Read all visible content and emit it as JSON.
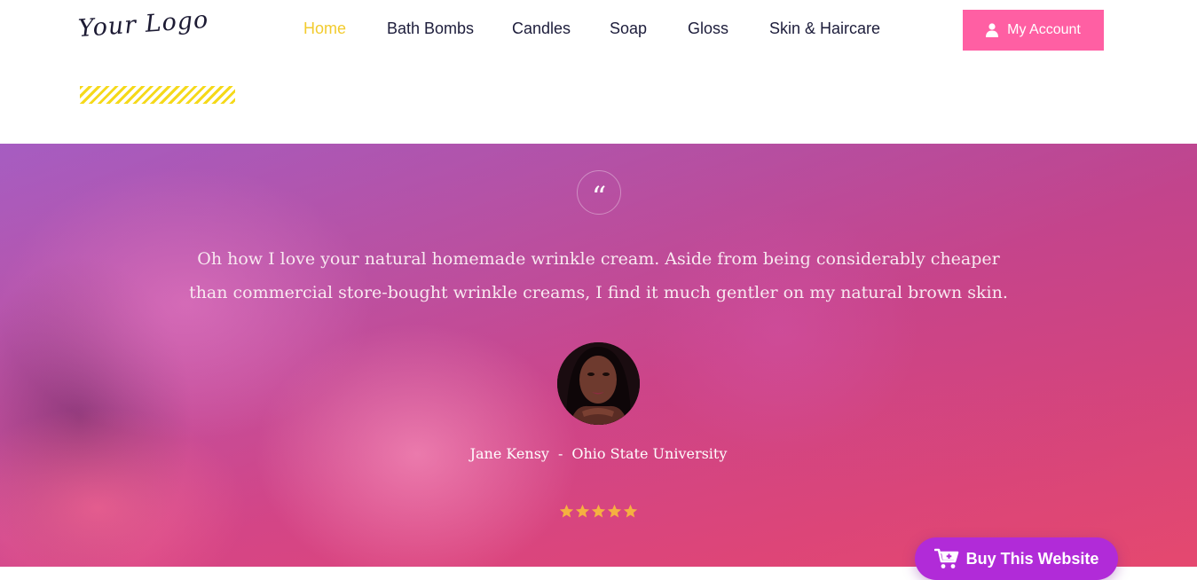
{
  "header": {
    "logo_text": "Your Logo",
    "nav": [
      {
        "label": "Home",
        "active": true
      },
      {
        "label": "Bath Bombs",
        "active": false
      },
      {
        "label": "Candles",
        "active": false
      },
      {
        "label": "Soap",
        "active": false
      },
      {
        "label": "Gloss",
        "active": false
      },
      {
        "label": "Skin & Haircare",
        "active": false
      }
    ],
    "account_label": "My Account",
    "account_icon": "user-icon"
  },
  "testimonial": {
    "quote_mark": "“",
    "quote": "Oh how I love your natural homemade wrinkle cream. Aside from being considerably cheaper than commercial store-bought wrinkle creams, I find it much gentler on my natural brown skin.",
    "author_name": "Jane Kensy",
    "separator": "-",
    "author_org": "Ohio State University",
    "rating": 5,
    "rating_max": 5
  },
  "buy_button": {
    "label": "Buy This Website",
    "icon": "cart-icon"
  },
  "colors": {
    "nav_active": "#f2cb2e",
    "nav_text": "#1d1d3b",
    "account_bg": "#ff5fa3",
    "stripe": "#f5d91a",
    "star": "#f5b041",
    "buy_bg": "#b12bd8"
  }
}
